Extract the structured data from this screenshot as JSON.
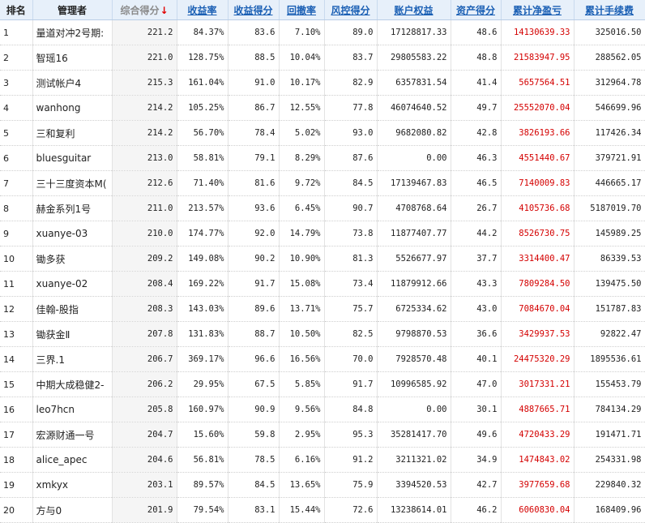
{
  "header": {
    "rank": "排名",
    "manager": "管理者",
    "total_score": "综合得分",
    "sort_arrow": "↓",
    "return_rate": "收益率",
    "return_score": "收益得分",
    "drawdown": "回撤率",
    "risk_score": "风控得分",
    "equity": "账户权益",
    "asset_score": "资产得分",
    "cum_pnl": "累计净盈亏",
    "cum_fee": "累计手续费"
  },
  "colors": {
    "header_link": "#1a5fb4",
    "pnl": "#d40000",
    "header_bg": "#e7f0fa"
  },
  "rows": [
    {
      "rank": "1",
      "manager": "量道对冲2号期:",
      "score": "221.2",
      "ret": "84.37%",
      "ret_score": "83.6",
      "dd": "7.10%",
      "risk": "89.0",
      "equity": "17128817.33",
      "asset": "48.6",
      "pnl": "14130639.33",
      "fee": "325016.50"
    },
    {
      "rank": "2",
      "manager": "智瑶16",
      "score": "221.0",
      "ret": "128.75%",
      "ret_score": "88.5",
      "dd": "10.04%",
      "risk": "83.7",
      "equity": "29805583.22",
      "asset": "48.8",
      "pnl": "21583947.95",
      "fee": "288562.05"
    },
    {
      "rank": "3",
      "manager": "测试帐户4",
      "score": "215.3",
      "ret": "161.04%",
      "ret_score": "91.0",
      "dd": "10.17%",
      "risk": "82.9",
      "equity": "6357831.54",
      "asset": "41.4",
      "pnl": "5657564.51",
      "fee": "312964.78"
    },
    {
      "rank": "4",
      "manager": "wanhong",
      "score": "214.2",
      "ret": "105.25%",
      "ret_score": "86.7",
      "dd": "12.55%",
      "risk": "77.8",
      "equity": "46074640.52",
      "asset": "49.7",
      "pnl": "25552070.04",
      "fee": "546699.96"
    },
    {
      "rank": "5",
      "manager": "三和复利",
      "score": "214.2",
      "ret": "56.70%",
      "ret_score": "78.4",
      "dd": "5.02%",
      "risk": "93.0",
      "equity": "9682080.82",
      "asset": "42.8",
      "pnl": "3826193.66",
      "fee": "117426.34"
    },
    {
      "rank": "6",
      "manager": "bluesguitar",
      "score": "213.0",
      "ret": "58.81%",
      "ret_score": "79.1",
      "dd": "8.29%",
      "risk": "87.6",
      "equity": "0.00",
      "asset": "46.3",
      "pnl": "4551440.67",
      "fee": "379721.91"
    },
    {
      "rank": "7",
      "manager": "三十三度资本M(",
      "score": "212.6",
      "ret": "71.40%",
      "ret_score": "81.6",
      "dd": "9.72%",
      "risk": "84.5",
      "equity": "17139467.83",
      "asset": "46.5",
      "pnl": "7140009.83",
      "fee": "446665.17"
    },
    {
      "rank": "8",
      "manager": "赫金系列1号",
      "score": "211.0",
      "ret": "213.57%",
      "ret_score": "93.6",
      "dd": "6.45%",
      "risk": "90.7",
      "equity": "4708768.64",
      "asset": "26.7",
      "pnl": "4105736.68",
      "fee": "5187019.70"
    },
    {
      "rank": "9",
      "manager": "xuanye-03",
      "score": "210.0",
      "ret": "174.77%",
      "ret_score": "92.0",
      "dd": "14.79%",
      "risk": "73.8",
      "equity": "11877407.77",
      "asset": "44.2",
      "pnl": "8526730.75",
      "fee": "145989.25"
    },
    {
      "rank": "10",
      "manager": "锄多获",
      "score": "209.2",
      "ret": "149.08%",
      "ret_score": "90.2",
      "dd": "10.90%",
      "risk": "81.3",
      "equity": "5526677.97",
      "asset": "37.7",
      "pnl": "3314400.47",
      "fee": "86339.53"
    },
    {
      "rank": "11",
      "manager": "xuanye-02",
      "score": "208.4",
      "ret": "169.22%",
      "ret_score": "91.7",
      "dd": "15.08%",
      "risk": "73.4",
      "equity": "11879912.66",
      "asset": "43.3",
      "pnl": "7809284.50",
      "fee": "139475.50"
    },
    {
      "rank": "12",
      "manager": "佳翰-股指",
      "score": "208.3",
      "ret": "143.03%",
      "ret_score": "89.6",
      "dd": "13.71%",
      "risk": "75.7",
      "equity": "6725334.62",
      "asset": "43.0",
      "pnl": "7084670.04",
      "fee": "151787.83"
    },
    {
      "rank": "13",
      "manager": "锄获金Ⅱ",
      "score": "207.8",
      "ret": "131.83%",
      "ret_score": "88.7",
      "dd": "10.50%",
      "risk": "82.5",
      "equity": "9798870.53",
      "asset": "36.6",
      "pnl": "3429937.53",
      "fee": "92822.47"
    },
    {
      "rank": "14",
      "manager": "三界.1",
      "score": "206.7",
      "ret": "369.17%",
      "ret_score": "96.6",
      "dd": "16.56%",
      "risk": "70.0",
      "equity": "7928570.48",
      "asset": "40.1",
      "pnl": "24475320.29",
      "fee": "1895536.61"
    },
    {
      "rank": "15",
      "manager": "中期大成稳健2-",
      "score": "206.2",
      "ret": "29.95%",
      "ret_score": "67.5",
      "dd": "5.85%",
      "risk": "91.7",
      "equity": "10996585.92",
      "asset": "47.0",
      "pnl": "3017331.21",
      "fee": "155453.79"
    },
    {
      "rank": "16",
      "manager": "leo7hcn",
      "score": "205.8",
      "ret": "160.97%",
      "ret_score": "90.9",
      "dd": "9.56%",
      "risk": "84.8",
      "equity": "0.00",
      "asset": "30.1",
      "pnl": "4887665.71",
      "fee": "784134.29"
    },
    {
      "rank": "17",
      "manager": "宏源财通一号",
      "score": "204.7",
      "ret": "15.60%",
      "ret_score": "59.8",
      "dd": "2.95%",
      "risk": "95.3",
      "equity": "35281417.70",
      "asset": "49.6",
      "pnl": "4720433.29",
      "fee": "191471.71"
    },
    {
      "rank": "18",
      "manager": "alice_apec",
      "score": "204.6",
      "ret": "56.81%",
      "ret_score": "78.5",
      "dd": "6.16%",
      "risk": "91.2",
      "equity": "3211321.02",
      "asset": "34.9",
      "pnl": "1474843.02",
      "fee": "254331.98"
    },
    {
      "rank": "19",
      "manager": "xmkyx",
      "score": "203.1",
      "ret": "89.57%",
      "ret_score": "84.5",
      "dd": "13.65%",
      "risk": "75.9",
      "equity": "3394520.53",
      "asset": "42.7",
      "pnl": "3977659.68",
      "fee": "229840.32"
    },
    {
      "rank": "20",
      "manager": "方与0",
      "score": "201.9",
      "ret": "79.54%",
      "ret_score": "83.1",
      "dd": "15.44%",
      "risk": "72.6",
      "equity": "13238614.01",
      "asset": "46.2",
      "pnl": "6060830.04",
      "fee": "168409.96"
    }
  ]
}
